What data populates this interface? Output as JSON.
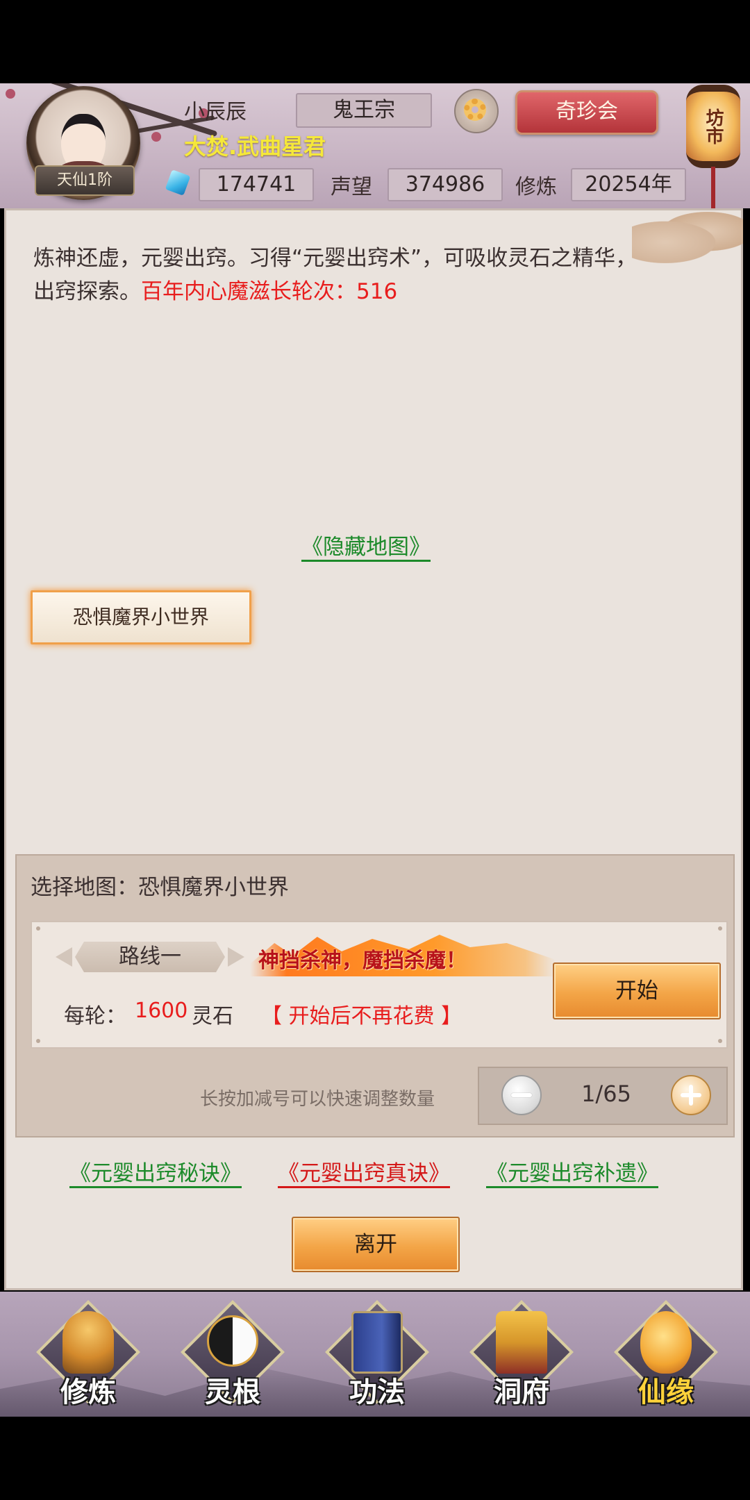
{
  "header": {
    "player_name": "小辰辰",
    "player_title": "大焚.武曲星君",
    "rank": "天仙1阶",
    "sect": "鬼王宗",
    "treasure_button": "奇珍会",
    "market_lantern": "坊市",
    "spirit_stones": "174741",
    "reputation_label": "声望",
    "reputation": "374986",
    "cultivation_label": "修炼",
    "cultivation": "20254年"
  },
  "main": {
    "description": "炼神还虚，元婴出窍。习得“元婴出窍术”，可吸收灵石之精华，出窍探索。",
    "demon_growth": "百年内心魔滋长轮次：516",
    "hidden_map_link": "《隐藏地图》",
    "map_button": "恐惧魔界小世界"
  },
  "selection": {
    "title": "选择地图：恐惧魔界小世界",
    "route_label": "路线一",
    "slogan": "神挡杀神，魔挡杀魔！",
    "cost_label": "每轮：",
    "cost_value": "1600",
    "cost_unit": "灵石",
    "no_cost_note": "【 开始后不再花费 】",
    "start_button": "开始",
    "long_press_hint": "长按加减号可以快速调整数量",
    "count": "1/65"
  },
  "skill_links": [
    {
      "label": "《元婴出窍秘诀》",
      "color": "#1c8a2a"
    },
    {
      "label": "《元婴出窍真诀》",
      "color": "#d41818"
    },
    {
      "label": "《元婴出窍补遗》",
      "color": "#1c8a2a"
    }
  ],
  "leave_button": "离开",
  "bottom_nav": [
    {
      "label": "修炼",
      "icon": "cultivator-icon"
    },
    {
      "label": "灵根",
      "icon": "spirit-root-icon"
    },
    {
      "label": "功法",
      "icon": "technique-book-icon"
    },
    {
      "label": "洞府",
      "icon": "cave-dwelling-icon"
    },
    {
      "label": "仙缘",
      "icon": "gourd-icon"
    }
  ],
  "colors": {
    "accent_red": "#e81d1d",
    "link_green": "#1c8a2a",
    "title_yellow": "#f5e83a",
    "button_orange": "#f3a547"
  }
}
